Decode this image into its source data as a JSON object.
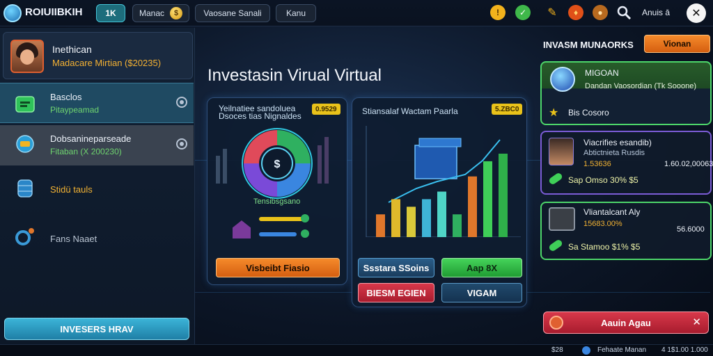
{
  "topbar": {
    "app_name": "ROIUIIBKIH",
    "level_chip": "1K",
    "currency_label": "Manac",
    "tab1": "Vaosane Sanali",
    "tab2": "Kanu",
    "user_label": "Anuis ā"
  },
  "sidebar": {
    "profile_name": "Inethican",
    "profile_sub": "Madacare Mirtian ($20235)",
    "items": [
      {
        "label": "Basclos",
        "sub": "Pitaypeamad"
      },
      {
        "label": "Dobsanineparseade",
        "sub": "Fitaban (X 200230)"
      },
      {
        "label": "Stidü tauls",
        "sub": ""
      },
      {
        "label": "Fans Naaet",
        "sub": ""
      }
    ],
    "invest_button": "INVESERS HRAV"
  },
  "main": {
    "title": "Investasin Virual Virtual",
    "card1": {
      "title_line1": "Yeilnatiee sandoluea",
      "title_line2": "Dsoces tias Nignaldes",
      "badge": "0.9529",
      "gauge_caption": "Tensibsgsano",
      "button": "Visbeibt Fiasio"
    },
    "card2": {
      "title": "Stiansalaf Wactam Paarla",
      "badge": "5.ZBC0",
      "chart_values": [
        3,
        5,
        4,
        5,
        6,
        3,
        8,
        10,
        11
      ],
      "bar_colors": [
        "#e0772b",
        "#e0b92b",
        "#d9c93a",
        "#3fb4d6",
        "#4fd4c6",
        "#2fb060",
        "#e0772b",
        "#3fcf58",
        "#2fb04a"
      ]
    },
    "buttons": {
      "b1": "Ssstara SSoins",
      "b2": "Aap 8X",
      "b3": "BIESM EGIEN",
      "b4": "VIGAM"
    }
  },
  "right_panel": {
    "title": "INVASM MUNAORKS",
    "header_button": "Vionan",
    "card1": {
      "title": "MIGOAN",
      "sub": "Dandan Vaosordian (Tk Sooone)",
      "footer": "Bis Cosoro"
    },
    "card2": {
      "title": "Viacrifies esandib)",
      "sub": "Abtictnieta Rusdis",
      "value_left": "1.53636",
      "value_right": "1.60.02,00063",
      "footer": "Sap Omso   30% $5"
    },
    "card3": {
      "title": "Vliantalcant Aly",
      "sub": "15683.00%",
      "value_right": "56.6000",
      "footer": "Sa Stamoo   $1% $5"
    },
    "action_button": "Aauin Agau"
  },
  "bottom": {
    "left": "$28",
    "center": "Fehaate Manan",
    "right": "4 1$1.00 1.000"
  },
  "colors": {
    "accent": "#3fb4d6",
    "green": "#45d35a",
    "orange": "#f58a2b",
    "red": "#d8384a",
    "gold": "#f5b233"
  }
}
